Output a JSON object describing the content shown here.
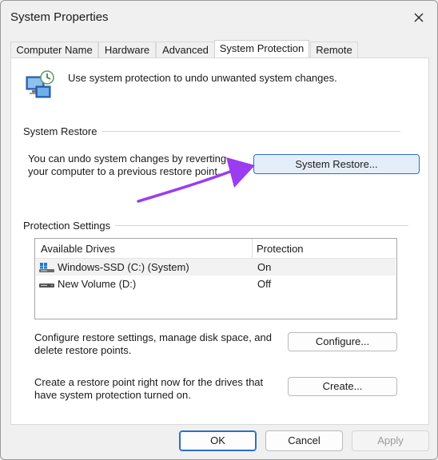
{
  "window": {
    "title": "System Properties"
  },
  "tabs": [
    {
      "label": "Computer Name"
    },
    {
      "label": "Hardware"
    },
    {
      "label": "Advanced"
    },
    {
      "label": "System Protection"
    },
    {
      "label": "Remote"
    }
  ],
  "header_text": "Use system protection to undo unwanted system changes.",
  "system_restore": {
    "group_title": "System Restore",
    "description_line1": "You can undo system changes by reverting",
    "description_line2": "your computer to a previous restore point.",
    "button_label": "System Restore..."
  },
  "protection": {
    "group_title": "Protection Settings",
    "columns": [
      "Available Drives",
      "Protection"
    ],
    "drives": [
      {
        "name": "Windows-SSD (C:) (System)",
        "protection": "On"
      },
      {
        "name": "New Volume (D:)",
        "protection": "Off"
      }
    ],
    "configure_text_line1": "Configure restore settings, manage disk space, and",
    "configure_text_line2": "delete restore points.",
    "configure_button": "Configure...",
    "create_text_line1": "Create a restore point right now for the drives that",
    "create_text_line2": "have system protection turned on.",
    "create_button": "Create..."
  },
  "footer": {
    "ok": "OK",
    "cancel": "Cancel",
    "apply": "Apply"
  },
  "colors": {
    "accent": "#2c6fc4",
    "annotation_arrow": "#9b3cf0"
  }
}
